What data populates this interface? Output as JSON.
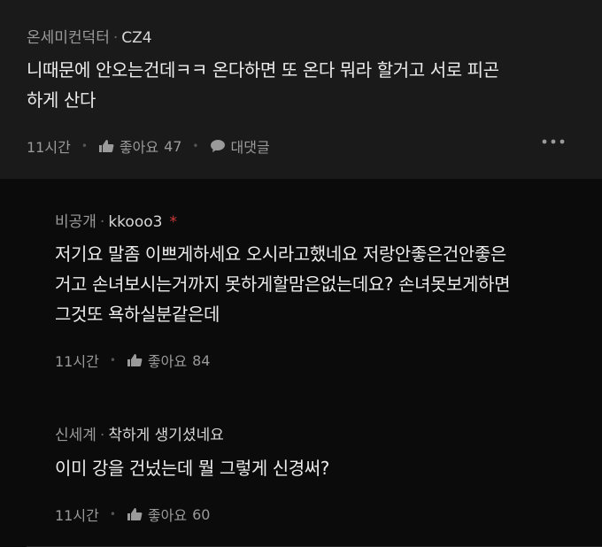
{
  "comments": [
    {
      "nickname": "온세미컨덕터",
      "author": "CZ4",
      "lines": [
        "니때문에 안오는건데ㅋㅋ 온다하면 또 온다 뭐라 할거고 서로 피곤",
        "하게 산다"
      ],
      "time": "11시간",
      "like_label": "좋아요",
      "like_count": "47",
      "reply_label": "대댓글",
      "more_icon": "more-horizontal-icon"
    }
  ],
  "replies": [
    {
      "nickname": "비공개",
      "author": "kkooo3",
      "badge": "*",
      "lines": [
        "저기요 말좀 이쁘게하세요 오시라고했네요 저랑안좋은건안좋은",
        "거고 손녀보시는거까지 못하게할맘은없는데요? 손녀못보게하면",
        "그것또 욕하실분같은데"
      ],
      "time": "11시간",
      "like_label": "좋아요",
      "like_count": "84"
    },
    {
      "nickname": "신세계",
      "author": "착하게 생기셨네요",
      "lines": [
        "이미 강을 건넜는데 뭘 그렇게 신경써?"
      ],
      "time": "11시간",
      "like_label": "좋아요",
      "like_count": "60"
    }
  ],
  "colors": {
    "background": "#121212",
    "comment_bg": "#1a1a1a",
    "reply_bg": "#0b0b0b",
    "badge": "#d23a3a"
  }
}
